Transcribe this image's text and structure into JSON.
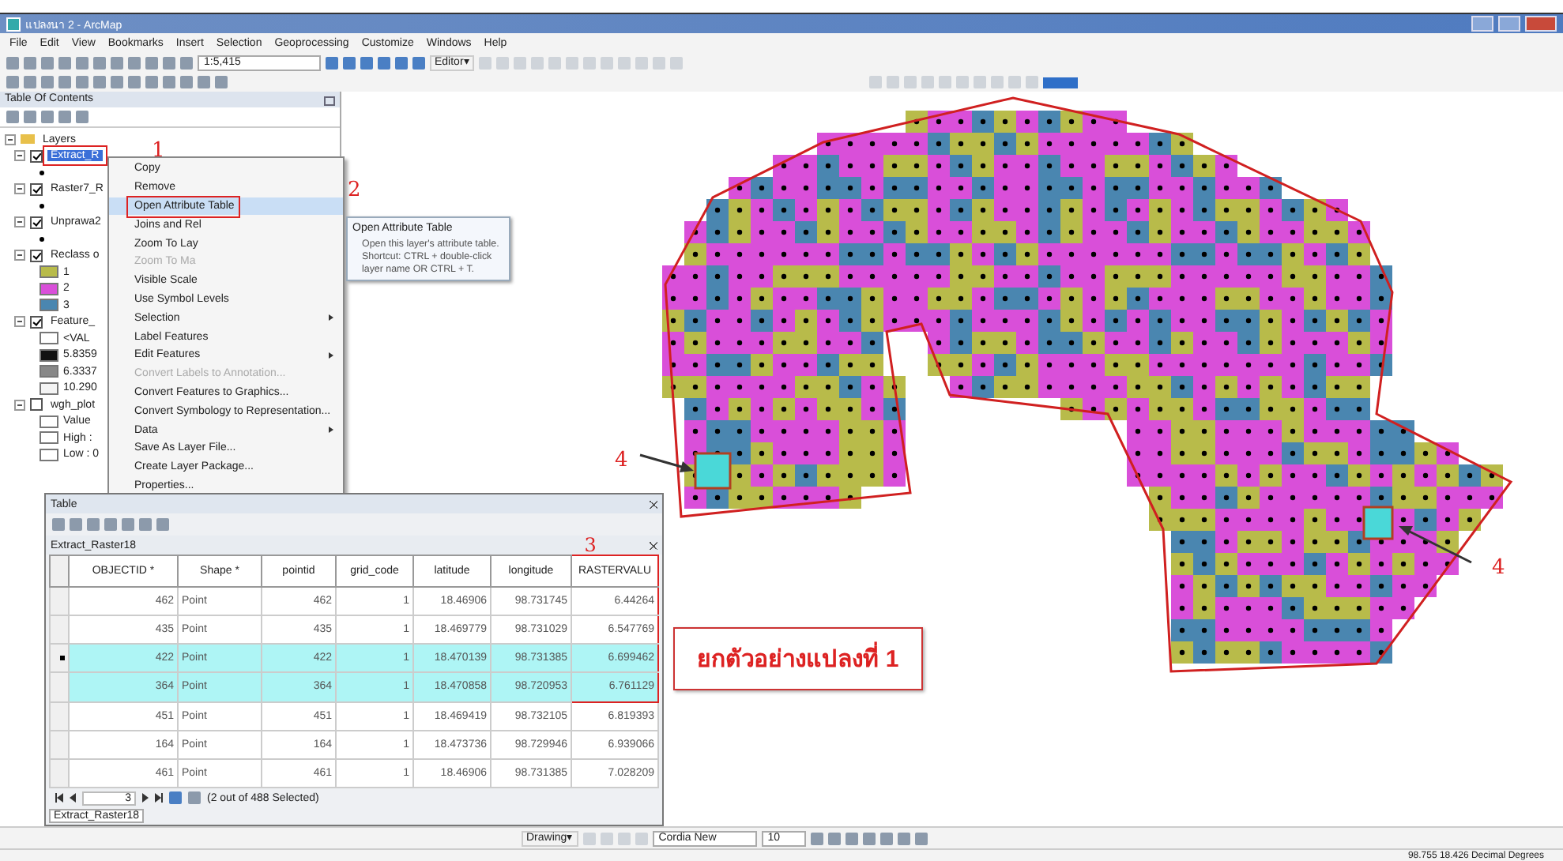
{
  "window": {
    "title": "แปลงนา 2 - ArcMap"
  },
  "menu": [
    "File",
    "Edit",
    "View",
    "Bookmarks",
    "Insert",
    "Selection",
    "Geoprocessing",
    "Customize",
    "Windows",
    "Help"
  ],
  "toolbar": {
    "scale": "1:5,415",
    "editor": "Editor▾"
  },
  "toc": {
    "title": "Table Of Contents",
    "root": "Layers",
    "layers": [
      {
        "name": "Extract_R",
        "checked": true,
        "selected": true
      },
      {
        "name": "Raster7_R",
        "checked": true,
        "selected": false
      },
      {
        "name": "Unprawa2",
        "checked": true,
        "selected": false
      },
      {
        "name": "Reclass o",
        "checked": true,
        "selected": false,
        "legend": [
          {
            "label": "1",
            "color": "#b8bb4a"
          },
          {
            "label": "2",
            "color": "#d94fd9"
          },
          {
            "label": "3",
            "color": "#4a86b0"
          }
        ]
      },
      {
        "name": "Feature_",
        "checked": true,
        "selected": false,
        "legend": [
          {
            "label": "<VAL",
            "color": "#ffffff"
          },
          {
            "label": "5.8359",
            "color": "#111111"
          },
          {
            "label": "6.3337",
            "color": "#888888"
          },
          {
            "label": "10.290",
            "color": "#f4f4f4"
          }
        ]
      },
      {
        "name": "wgh_plot",
        "checked": false,
        "selected": false,
        "legend": [
          {
            "label": "Value",
            "color": "#ffffff"
          },
          {
            "label": "High :",
            "color": "#ffffff"
          },
          {
            "label": "Low : 0",
            "color": "#ffffff"
          }
        ]
      }
    ]
  },
  "context_menu": {
    "items": [
      {
        "label": "Copy",
        "disabled": false,
        "submenu": false,
        "selected": false
      },
      {
        "label": "Remove",
        "disabled": false,
        "submenu": false,
        "selected": false
      },
      {
        "label": "Open Attribute Table",
        "disabled": false,
        "submenu": false,
        "selected": true
      },
      {
        "label": "Joins and Rel",
        "disabled": false,
        "submenu": false,
        "selected": false
      },
      {
        "label": "Zoom To Lay",
        "disabled": false,
        "submenu": false,
        "selected": false
      },
      {
        "label": "Zoom To Ma",
        "disabled": true,
        "submenu": false,
        "selected": false
      },
      {
        "label": "Visible Scale",
        "disabled": false,
        "submenu": false,
        "selected": false
      },
      {
        "label": "Use Symbol Levels",
        "disabled": false,
        "submenu": false,
        "selected": false
      },
      {
        "label": "Selection",
        "disabled": false,
        "submenu": true,
        "selected": false
      },
      {
        "label": "Label Features",
        "disabled": false,
        "submenu": false,
        "selected": false
      },
      {
        "label": "Edit Features",
        "disabled": false,
        "submenu": true,
        "selected": false
      },
      {
        "label": "Convert Labels to Annotation...",
        "disabled": true,
        "submenu": false,
        "selected": false
      },
      {
        "label": "Convert Features to Graphics...",
        "disabled": false,
        "submenu": false,
        "selected": false
      },
      {
        "label": "Convert Symbology to Representation...",
        "disabled": false,
        "submenu": false,
        "selected": false
      },
      {
        "label": "Data",
        "disabled": false,
        "submenu": true,
        "selected": false
      },
      {
        "label": "Save As Layer File...",
        "disabled": false,
        "submenu": false,
        "selected": false
      },
      {
        "label": "Create Layer Package...",
        "disabled": false,
        "submenu": false,
        "selected": false
      },
      {
        "label": "Properties...",
        "disabled": false,
        "submenu": false,
        "selected": false
      }
    ]
  },
  "tooltip": {
    "title": "Open Attribute Table",
    "text": "Open this layer's attribute table. Shortcut: CTRL + double-click layer name OR CTRL + T."
  },
  "table": {
    "title": "Table",
    "tab": "Extract_Raster18",
    "columns": [
      "OBJECTID *",
      "Shape *",
      "pointid",
      "grid_code",
      "latitude",
      "longitude",
      "RASTERVALU"
    ],
    "rows": [
      {
        "cells": [
          "462",
          "Point",
          "462",
          "1",
          "18.46906",
          "98.731745",
          "6.44264"
        ],
        "selected": false,
        "current": false
      },
      {
        "cells": [
          "435",
          "Point",
          "435",
          "1",
          "18.469779",
          "98.731029",
          "6.547769"
        ],
        "selected": false,
        "current": false
      },
      {
        "cells": [
          "422",
          "Point",
          "422",
          "1",
          "18.470139",
          "98.731385",
          "6.699462"
        ],
        "selected": true,
        "current": true
      },
      {
        "cells": [
          "364",
          "Point",
          "364",
          "1",
          "18.470858",
          "98.720953",
          "6.761129"
        ],
        "selected": true,
        "current": false
      },
      {
        "cells": [
          "451",
          "Point",
          "451",
          "1",
          "18.469419",
          "98.732105",
          "6.819393"
        ],
        "selected": false,
        "current": false
      },
      {
        "cells": [
          "164",
          "Point",
          "164",
          "1",
          "18.473736",
          "98.729946",
          "6.939066"
        ],
        "selected": false,
        "current": false
      },
      {
        "cells": [
          "461",
          "Point",
          "461",
          "1",
          "18.46906",
          "98.731385",
          "7.028209"
        ],
        "selected": false,
        "current": false
      }
    ],
    "record": "3",
    "status": "(2 out of 488 Selected)",
    "bottom_tab": "Extract_Raster18"
  },
  "annotations": {
    "marks": [
      "1",
      "2",
      "3",
      "4",
      "4"
    ],
    "caption": "ยกตัวอย่างแปลงที่ 1"
  },
  "drawing_toolbar": {
    "label": "Drawing▾",
    "font": "Cordia New",
    "size": "10"
  },
  "status_bar": {
    "coordinates": "98.755 18.426 Decimal Degrees"
  }
}
